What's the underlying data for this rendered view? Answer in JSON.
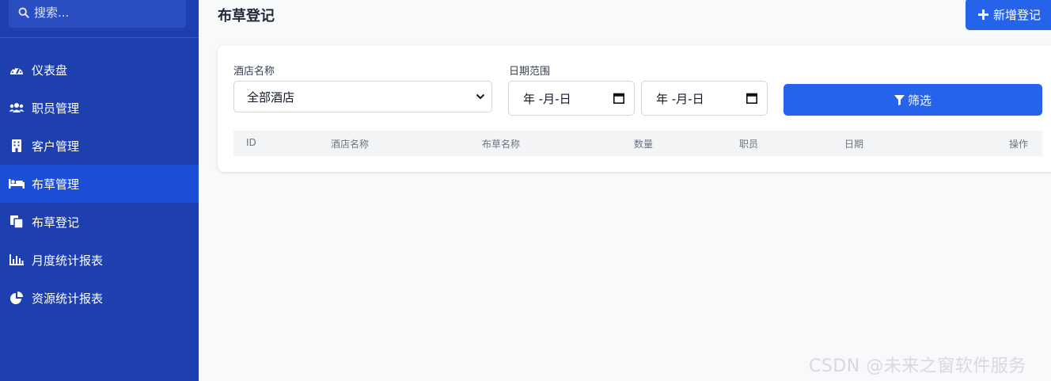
{
  "sidebar": {
    "search_placeholder": "搜索...",
    "items": [
      {
        "label": "仪表盘",
        "icon": "dashboard-icon",
        "active": false
      },
      {
        "label": "职员管理",
        "icon": "users-icon",
        "active": false
      },
      {
        "label": "客户管理",
        "icon": "building-icon",
        "active": false
      },
      {
        "label": "布草管理",
        "icon": "bed-icon",
        "active": true
      },
      {
        "label": "布草登记",
        "icon": "copy-icon",
        "active": false
      },
      {
        "label": "月度统计报表",
        "icon": "bar-chart-icon",
        "active": false
      },
      {
        "label": "资源统计报表",
        "icon": "pie-chart-icon",
        "active": false
      }
    ]
  },
  "header": {
    "title": "布草登记",
    "add_button": "新增登记"
  },
  "filters": {
    "hotel_label": "酒店名称",
    "hotel_value": "全部酒店",
    "date_label": "日期范围",
    "date_start": "年 -月-日",
    "date_end": "年 -月-日",
    "filter_button": "筛选"
  },
  "table": {
    "columns": [
      "ID",
      "酒店名称",
      "布草名称",
      "数量",
      "职员",
      "日期",
      "操作"
    ]
  },
  "watermark": "CSDN @未来之窗软件服务",
  "colors": {
    "sidebar": "#1e40af",
    "sidebar_active": "#1d4ed8",
    "primary_button": "#2563eb"
  }
}
